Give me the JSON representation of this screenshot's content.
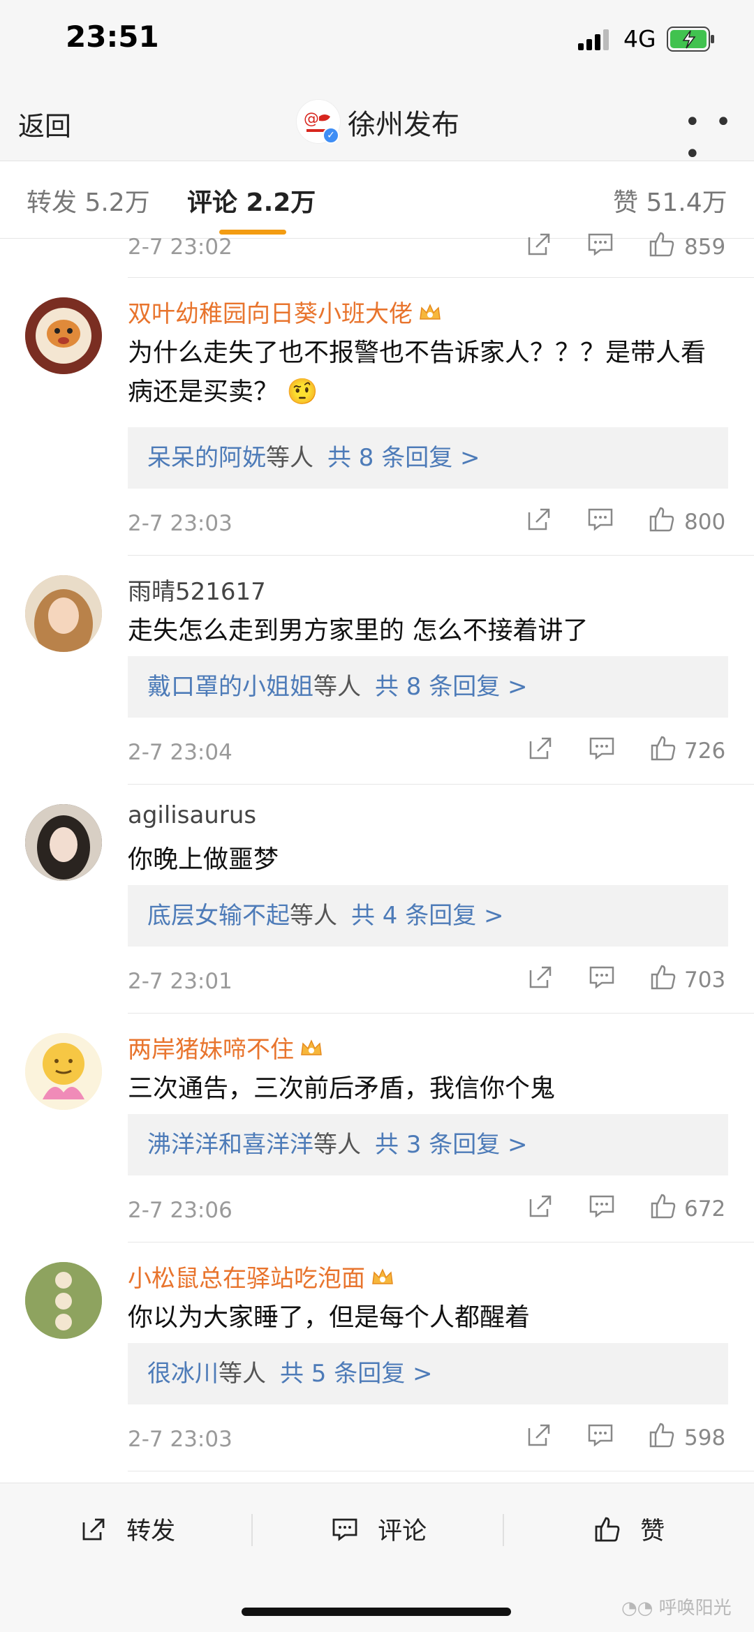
{
  "status_bar": {
    "time": "23:51",
    "network": "4G"
  },
  "nav": {
    "back_label": "返回",
    "title": "徐州发布",
    "more_label": "• • •"
  },
  "tabs": {
    "repost": "转发 5.2万",
    "comment": "评论 2.2万",
    "like": "赞 51.4万"
  },
  "first_meta": {
    "date": "2-7 23:02",
    "likes": "859"
  },
  "comments": [
    {
      "user": "双叶幼稚园向日葵小班大佬",
      "vip": true,
      "text": "为什么走失了也不报警也不告诉家人？？？是带人看病还是买卖？",
      "emoji": "🤨",
      "reply_users": "呆呆的阿妩",
      "reply_suffix": "等人",
      "reply_count": "共 8 条回复 >",
      "date": "2-7 23:03",
      "likes": "800"
    },
    {
      "user": "雨晴521617",
      "vip": false,
      "text": "走失怎么走到男方家里的  怎么不接着讲了",
      "reply_users": "戴口罩的小姐姐",
      "reply_suffix": "等人",
      "reply_count": "共 8 条回复 >",
      "date": "2-7 23:04",
      "likes": "726"
    },
    {
      "user": "agilisaurus",
      "vip": false,
      "text": "你晚上做噩梦",
      "reply_users": "底层女输不起",
      "reply_suffix": "等人",
      "reply_count": "共 4 条回复 >",
      "date": "2-7 23:01",
      "likes": "703"
    },
    {
      "user": "两岸猪妹啼不住",
      "vip": true,
      "text": "三次通告，三次前后矛盾，我信你个鬼",
      "reply_users": "沸洋洋和喜洋洋",
      "reply_suffix": "等人",
      "reply_count": "共 3 条回复 >",
      "date": "2-7 23:06",
      "likes": "672"
    },
    {
      "user": "小松鼠总在驿站吃泡面",
      "vip": true,
      "text": "你以为大家睡了，但是每个人都醒着",
      "reply_users": "很冰川",
      "reply_suffix": "等人",
      "reply_count": "共 5 条回复 >",
      "date": "2-7 23:03",
      "likes": "598"
    }
  ],
  "bottom_bar": {
    "repost": "转发",
    "comment": "评论",
    "like": "赞"
  },
  "watermark": "呼唤阳光",
  "colors": {
    "vip_name": "#e8742d",
    "reply_link": "#4d7bb8",
    "tab_accent": "#f39c12"
  }
}
